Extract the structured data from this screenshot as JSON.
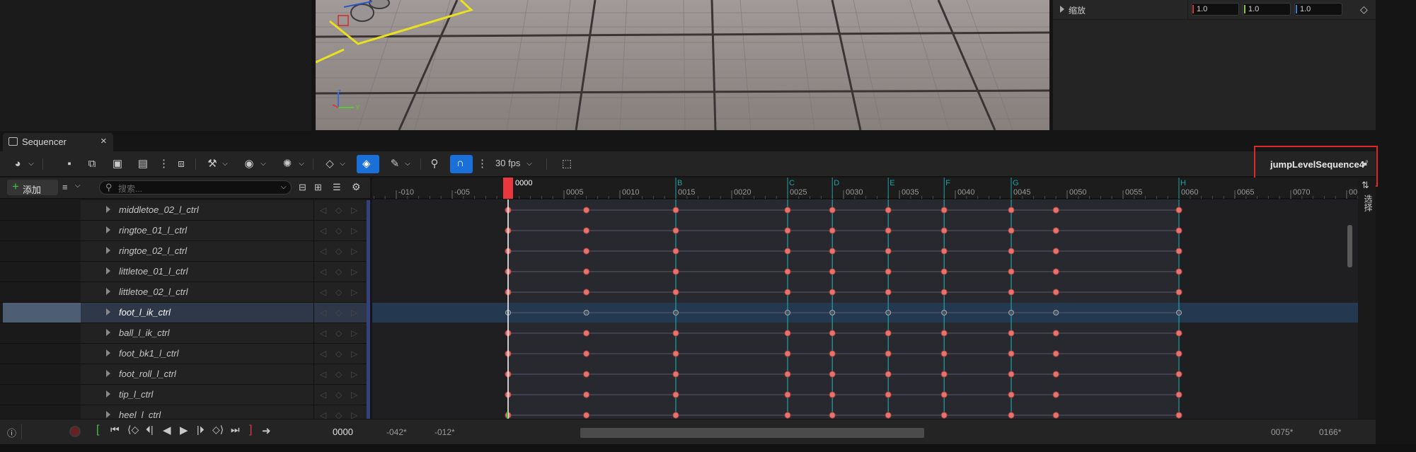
{
  "details": {
    "scale_label": "缩放",
    "scale_x": "1.0",
    "scale_y": "1.0",
    "scale_z": "1.0"
  },
  "tab": {
    "title": "Sequencer",
    "close": "×"
  },
  "toolbar": {
    "fps": "30 fps",
    "sequence_name": "jumpLevelSequence4"
  },
  "tree_header": {
    "add_label": "添加",
    "search_placeholder": "搜索..."
  },
  "ruler": {
    "current_frame": "0000",
    "ticks": [
      "-010",
      "-005",
      "0005",
      "0010",
      "0015",
      "0020",
      "0025",
      "0030",
      "0035",
      "0040",
      "0045",
      "0050",
      "0055",
      "0060",
      "0065",
      "0070",
      "00"
    ],
    "markers": [
      "B",
      "C",
      "D",
      "E",
      "F",
      "G",
      "H"
    ]
  },
  "tree": {
    "rows": [
      {
        "label": "middletoe_02_l_ctrl"
      },
      {
        "label": "ringtoe_01_l_ctrl"
      },
      {
        "label": "ringtoe_02_l_ctrl"
      },
      {
        "label": "littletoe_01_l_ctrl"
      },
      {
        "label": "littletoe_02_l_ctrl"
      },
      {
        "label": "foot_l_ik_ctrl"
      },
      {
        "label": "ball_l_ik_ctrl"
      },
      {
        "label": "foot_bk1_l_ctrl"
      },
      {
        "label": "foot_roll_l_ctrl"
      },
      {
        "label": "tip_l_ctrl"
      },
      {
        "label": "heel_l_ctrl"
      }
    ],
    "selected_index": 5
  },
  "side_tab": {
    "label": "选择"
  },
  "transport": {
    "frame": "0000",
    "range_start_out": "-042*",
    "range_start_in": "-012*",
    "range_end_in": "0075*",
    "range_end_out": "0166*"
  },
  "colors": {
    "key": "#e8736e",
    "marker": "#1fa3a3",
    "playhead": "#e8383d",
    "selected_row": "#2e3848",
    "accent_blue": "#1a6fd8"
  }
}
